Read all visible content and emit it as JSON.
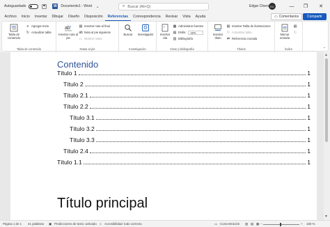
{
  "titlebar": {
    "autosave_label": "Autoguardado",
    "doc_title": "Documento1 - Word",
    "search_placeholder": "Buscar (Alt+Q)",
    "user_name": "Edgar Chero",
    "user_initials": "EC",
    "win_minimize": "—",
    "win_restore": "❐",
    "win_close": "✕"
  },
  "tabs": [
    "Archivo",
    "Inicio",
    "Insertar",
    "Dibujar",
    "Diseño",
    "Disposición",
    "Referencias",
    "Correspondencia",
    "Revisar",
    "Vista",
    "Ayuda"
  ],
  "active_tab": "Referencias",
  "header_buttons": {
    "comments": "Comentarios",
    "share": "Compartir"
  },
  "ribbon": {
    "toc_group": {
      "label": "Tabla de contenido",
      "toc_button": "Tabla de contenido",
      "add_text": "Agregar texto",
      "update_table": "Actualizar tabla"
    },
    "footnotes_group": {
      "label": "Notas al pie",
      "insert_footnote": "Insertar nota al pie",
      "insert_endnote": "Insertar nota al final",
      "next_footnote": "Nota al pie siguiente",
      "show_notes": "Mostrar notas"
    },
    "research_group": {
      "label": "Investigación",
      "search": "Buscar",
      "researcher": "Investigador"
    },
    "citations_group": {
      "label": "Citas y bibliografía",
      "insert_citation": "Insertar cita",
      "manage_sources": "Administrar fuentes",
      "style_label": "Estilo:",
      "style_value": "APA",
      "bibliography": "Bibliografía"
    },
    "captions_group": {
      "label": "Títulos",
      "insert_caption": "Insertar título",
      "insert_table_of_figures": "Insertar Tabla de ilustraciones",
      "update_table": "Actualizar tabla",
      "cross_reference": "Referencia cruzada"
    },
    "index_group": {
      "label": "Índice",
      "mark_entry": "Marcar entrada"
    }
  },
  "document": {
    "toc_title": "Contenido",
    "toc_entries": [
      {
        "label": "Título 1",
        "page": "1",
        "level": 1
      },
      {
        "label": "Título 2",
        "page": "1",
        "level": 2
      },
      {
        "label": "Título 2.1",
        "page": "1",
        "level": 2
      },
      {
        "label": "Título 2.2",
        "page": "1",
        "level": 2
      },
      {
        "label": "Título 3.1",
        "page": "1",
        "level": 3
      },
      {
        "label": "Título 3.2",
        "page": "1",
        "level": 3
      },
      {
        "label": "Título 3.3",
        "page": "1",
        "level": 3
      },
      {
        "label": "Título 2.4",
        "page": "1",
        "level": 2
      },
      {
        "label": "Título 1.1",
        "page": "1",
        "level": 1
      }
    ],
    "heading": "Título principal"
  },
  "statusbar": {
    "page": "Página 1 de 1",
    "words": "41 palabras",
    "language_icon": "proofing-icon",
    "predictions": "Predicciones de texto: activado",
    "accessibility": "Accesibilidad: todo correcto",
    "focus": "Concentración",
    "zoom": "160 %"
  },
  "colors": {
    "accent": "#185abd",
    "toc_heading": "#2f5496",
    "word_brand": "#2b579a"
  }
}
